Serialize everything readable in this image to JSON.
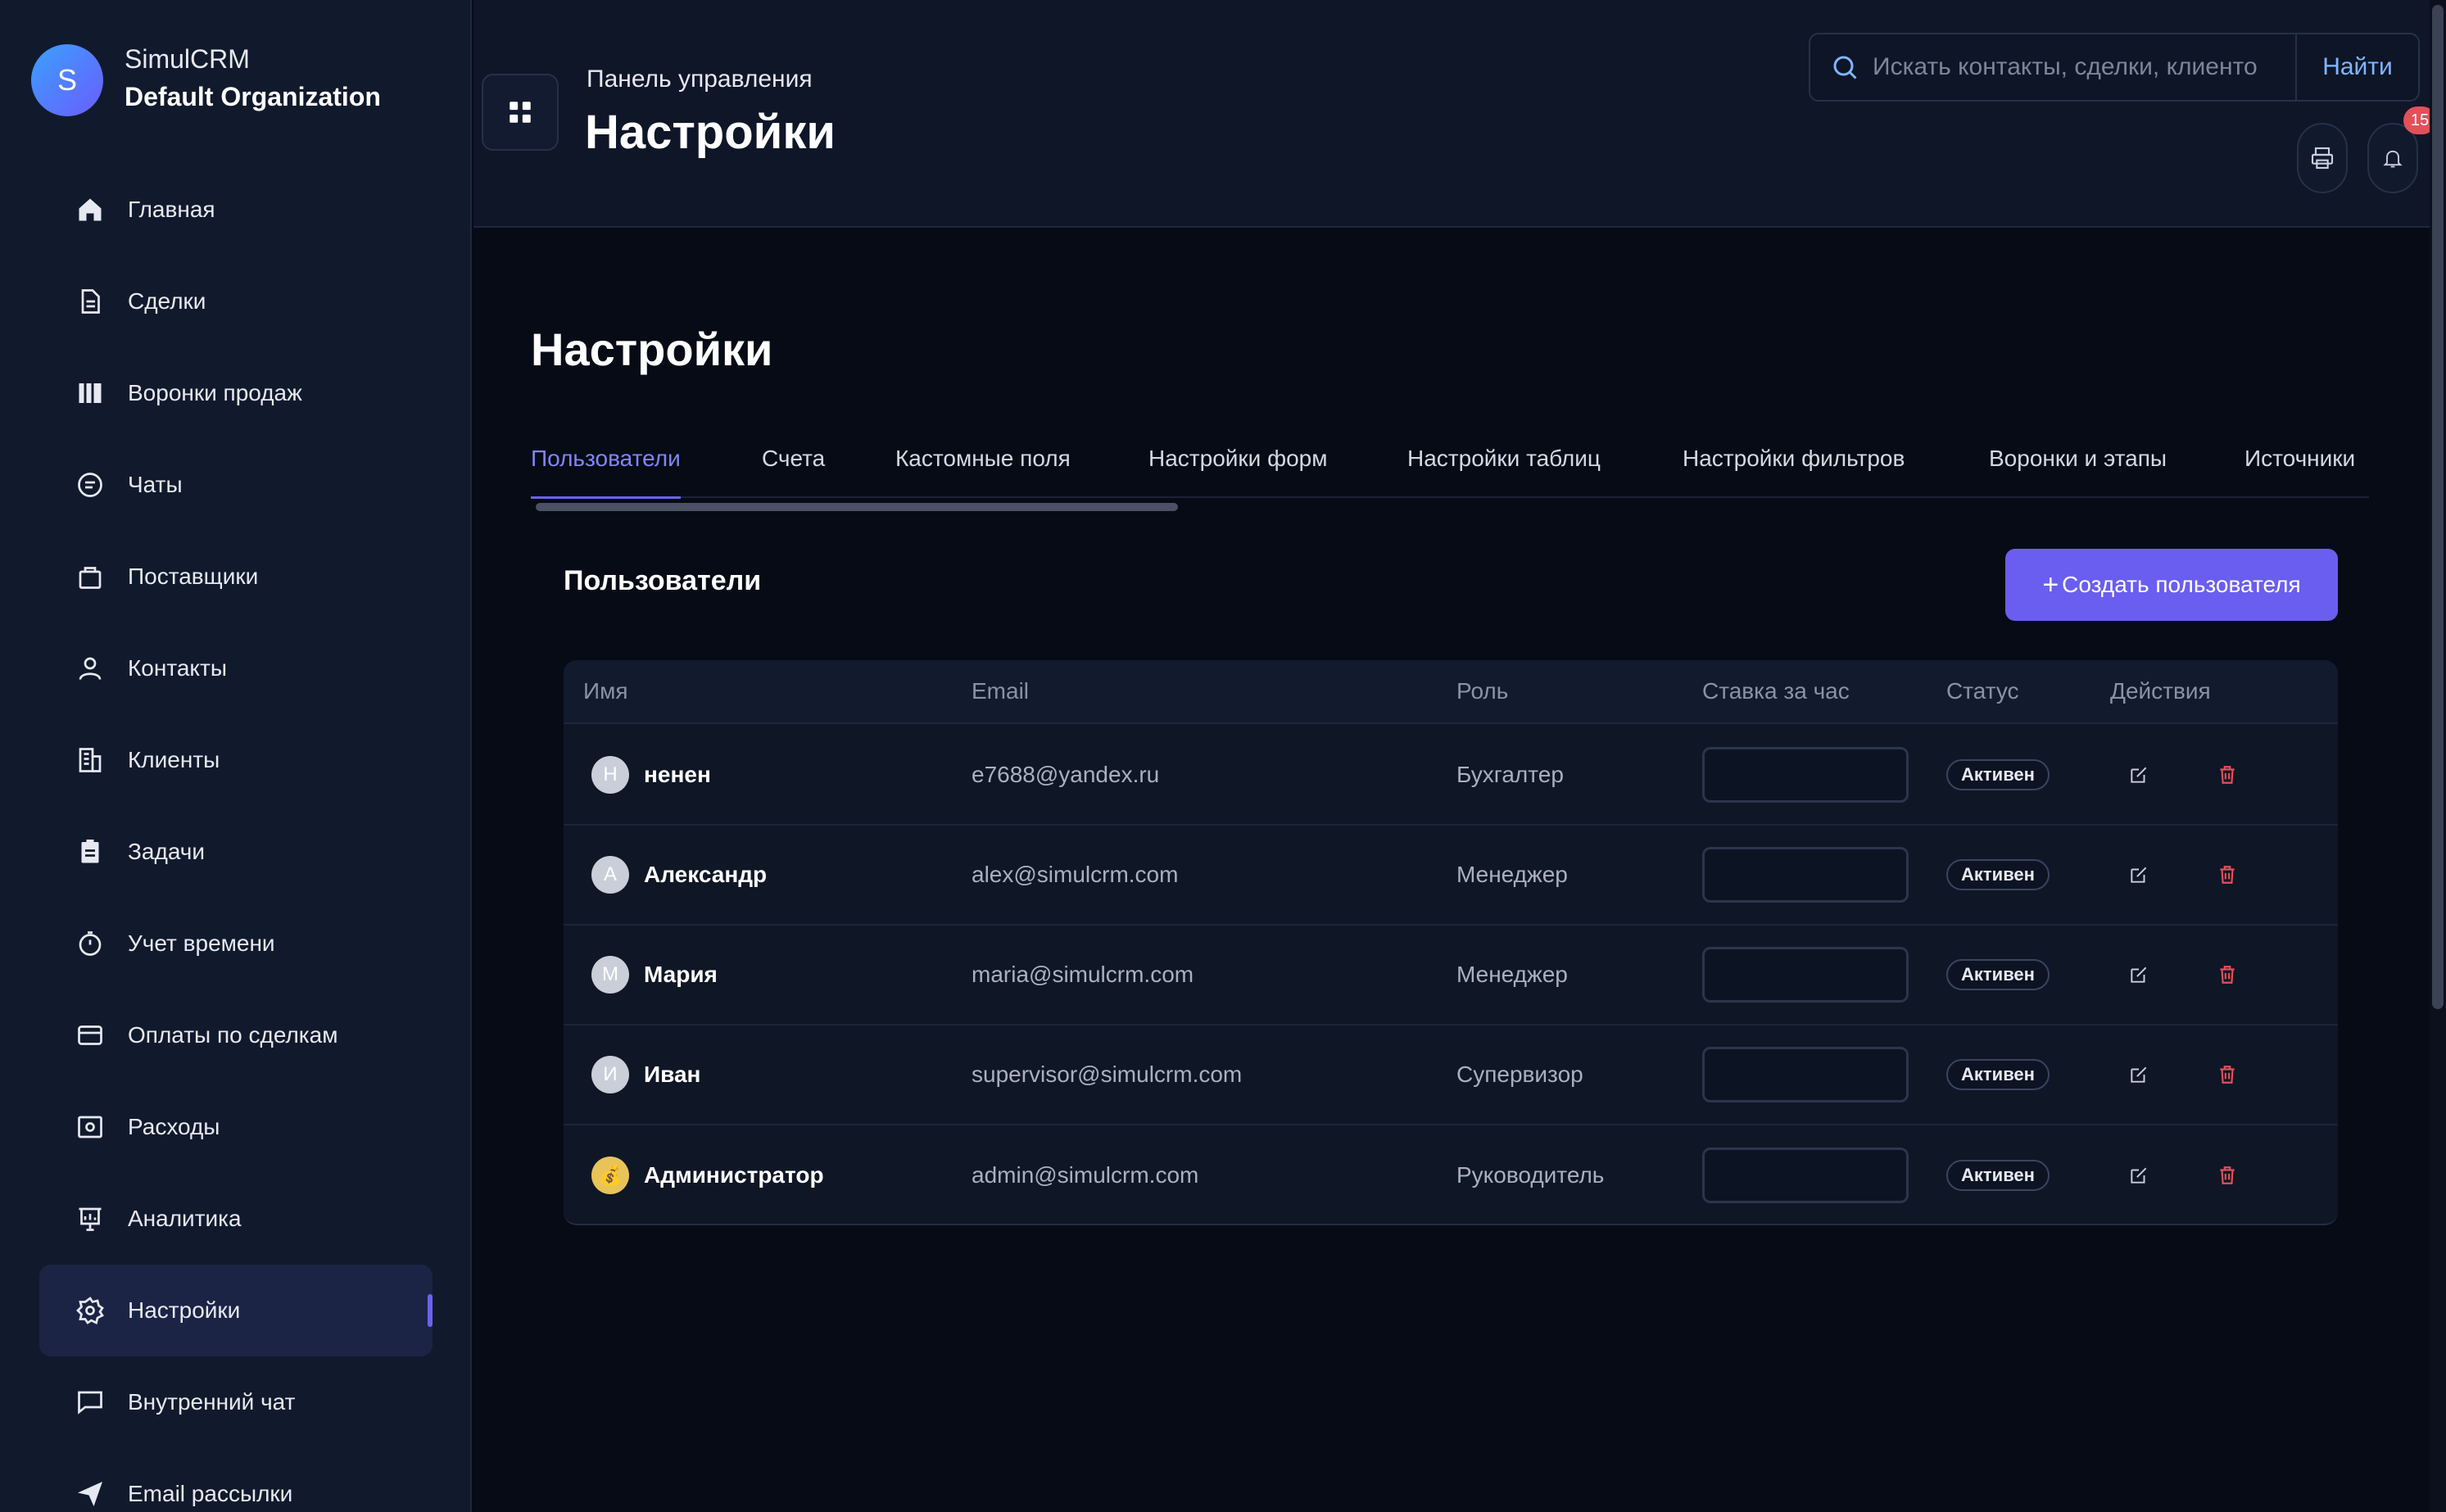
{
  "brand": {
    "initial": "S",
    "name": "SimulCRM",
    "org": "Default Organization"
  },
  "sidebar": {
    "items": [
      {
        "label": "Главная",
        "icon": "home-icon"
      },
      {
        "label": "Сделки",
        "icon": "document-icon"
      },
      {
        "label": "Воронки продаж",
        "icon": "pipeline-icon"
      },
      {
        "label": "Чаты",
        "icon": "chat-icon"
      },
      {
        "label": "Поставщики",
        "icon": "bag-icon"
      },
      {
        "label": "Контакты",
        "icon": "user-icon"
      },
      {
        "label": "Клиенты",
        "icon": "building-icon"
      },
      {
        "label": "Задачи",
        "icon": "clipboard-icon"
      },
      {
        "label": "Учет времени",
        "icon": "stopwatch-icon"
      },
      {
        "label": "Оплаты по сделкам",
        "icon": "credit-card-icon"
      },
      {
        "label": "Расходы",
        "icon": "wallet-icon"
      },
      {
        "label": "Аналитика",
        "icon": "presentation-chart-icon"
      },
      {
        "label": "Настройки",
        "icon": "gear-icon",
        "active": true
      },
      {
        "label": "Внутренний чат",
        "icon": "message-square-icon"
      },
      {
        "label": "Email рассылки",
        "icon": "send-icon"
      }
    ]
  },
  "header": {
    "breadcrumb": "Панель управления",
    "title": "Настройки",
    "search_placeholder": "Искать контакты, сделки, клиенто",
    "search_button": "Найти",
    "notification_count": "15"
  },
  "main": {
    "title": "Настройки",
    "tabs": [
      {
        "label": "Пользователи",
        "active": true
      },
      {
        "label": "Счета"
      },
      {
        "label": "Кастомные поля"
      },
      {
        "label": "Настройки форм"
      },
      {
        "label": "Настройки таблиц"
      },
      {
        "label": "Настройки фильтров"
      },
      {
        "label": "Воронки и этапы"
      },
      {
        "label": "Источники"
      }
    ],
    "section_title": "Пользователи",
    "create_button": "Создать пользователя",
    "create_button_plus": "+",
    "table": {
      "columns": [
        "Имя",
        "Email",
        "Роль",
        "Ставка за час",
        "Статус",
        "Действия"
      ],
      "rows": [
        {
          "initial": "Н",
          "name": "ненен",
          "email": "e7688@yandex.ru",
          "role": "Бухгалтер",
          "rate": "",
          "status": "Активен"
        },
        {
          "initial": "А",
          "name": "Александр",
          "email": "alex@simulcrm.com",
          "role": "Менеджер",
          "rate": "",
          "status": "Активен"
        },
        {
          "initial": "М",
          "name": "Мария",
          "email": "maria@simulcrm.com",
          "role": "Менеджер",
          "rate": "",
          "status": "Активен"
        },
        {
          "initial": "И",
          "name": "Иван",
          "email": "supervisor@simulcrm.com",
          "role": "Супервизор",
          "rate": "",
          "status": "Активен"
        },
        {
          "initial": "💰",
          "name": "Администратор",
          "email": "admin@simulcrm.com",
          "role": "Руководитель",
          "rate": "",
          "status": "Активен"
        }
      ]
    }
  },
  "colors": {
    "accent": "#6a5ef0",
    "active_tab": "#7f86f6",
    "delete": "#e2505a",
    "background": "#070b16",
    "sidebar": "#111a2c"
  }
}
